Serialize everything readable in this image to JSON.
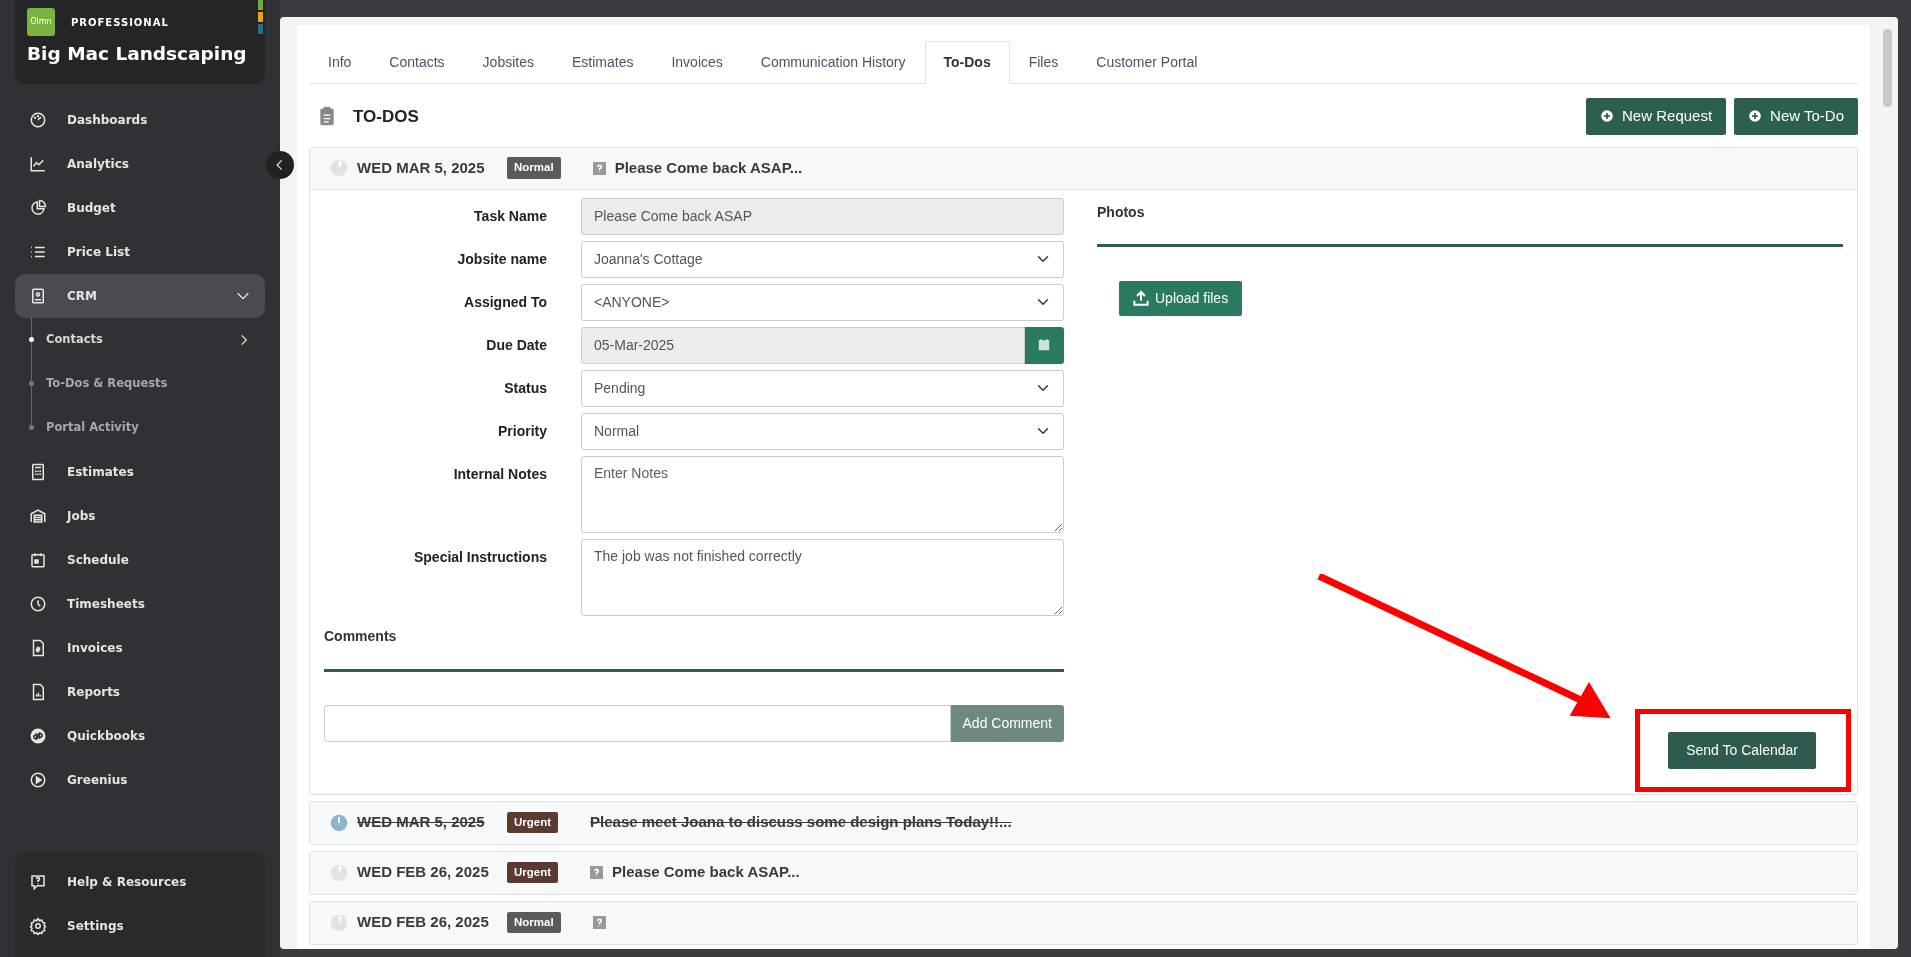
{
  "sidebar": {
    "logo": "Olmn",
    "tier": "PROFESSIONAL",
    "company": "Big Mac Landscaping",
    "items": [
      {
        "label": "Dashboards",
        "selected": false
      },
      {
        "label": "Analytics",
        "selected": false
      },
      {
        "label": "Budget",
        "selected": false
      },
      {
        "label": "Price List",
        "selected": false
      },
      {
        "label": "CRM",
        "selected": true,
        "expanded": true,
        "children": [
          {
            "label": "Contacts",
            "selected": true
          },
          {
            "label": "To-Dos & Requests",
            "selected": false
          },
          {
            "label": "Portal Activity",
            "selected": false
          }
        ]
      },
      {
        "label": "Estimates",
        "selected": false
      },
      {
        "label": "Jobs",
        "selected": false
      },
      {
        "label": "Schedule",
        "selected": false
      },
      {
        "label": "Timesheets",
        "selected": false
      },
      {
        "label": "Invoices",
        "selected": false
      },
      {
        "label": "Reports",
        "selected": false
      },
      {
        "label": "Quickbooks",
        "selected": false
      },
      {
        "label": "Greenius",
        "selected": false
      }
    ],
    "footer_items": [
      {
        "label": "Help & Resources"
      },
      {
        "label": "Settings"
      }
    ]
  },
  "tabs": [
    {
      "label": "Info",
      "selected": false
    },
    {
      "label": "Contacts",
      "selected": false
    },
    {
      "label": "Jobsites",
      "selected": false
    },
    {
      "label": "Estimates",
      "selected": false
    },
    {
      "label": "Invoices",
      "selected": false
    },
    {
      "label": "Communication History",
      "selected": false
    },
    {
      "label": "To-Dos",
      "selected": true
    },
    {
      "label": "Files",
      "selected": false
    },
    {
      "label": "Customer Portal",
      "selected": false
    }
  ],
  "section_title": "TO-DOS",
  "actions": [
    "New Request",
    "New To-Do"
  ],
  "todos": [
    {
      "date": "WED MAR 5, 2025",
      "priority": "Normal",
      "color": "#5a5a5a",
      "title": "Please Come back ASAP...",
      "completed": false,
      "flagged": true,
      "expanded": true,
      "detail": {
        "fields": [
          {
            "kind": "text",
            "label": "Task Name",
            "value": "Please Come back ASAP",
            "readonly": true
          },
          {
            "kind": "select",
            "label": "Jobsite name",
            "value": "Joanna's Cottage",
            "readonly": false
          },
          {
            "kind": "select",
            "label": "Assigned To",
            "value": "<ANYONE>",
            "readonly": false
          },
          {
            "kind": "date",
            "label": "Due Date",
            "value": "05-Mar-2025",
            "readonly": true
          },
          {
            "kind": "select",
            "label": "Status",
            "value": "Pending",
            "readonly": false
          },
          {
            "kind": "select",
            "label": "Priority",
            "value": "Normal",
            "readonly": false
          },
          {
            "kind": "textarea",
            "label": "Internal Notes",
            "placeholder": "Enter Notes",
            "readonly": false
          },
          {
            "kind": "textarea",
            "label": "Special Instructions",
            "value": "The job was not finished correctly",
            "readonly": false
          }
        ],
        "comments_title": "Comments",
        "comment_button": "Add Comment",
        "photos_title": "Photos",
        "upload_button": "Upload files",
        "calendar_button": "Send To Calendar"
      }
    },
    {
      "date": "WED MAR 5, 2025",
      "priority": "Urgent",
      "color": "#5b3b30",
      "title": "Please meet Joana to discuss some design plans Today!!...",
      "completed": true,
      "flagged": false,
      "expanded": false
    },
    {
      "date": "WED FEB 26, 2025",
      "priority": "Urgent",
      "color": "#5b3b30",
      "title": "Please Come back ASAP...",
      "completed": false,
      "flagged": true,
      "expanded": false
    },
    {
      "date": "WED FEB 26, 2025",
      "priority": "Normal",
      "color": "#5a5a5a",
      "completed": false,
      "flagged": true,
      "expanded": false
    }
  ]
}
